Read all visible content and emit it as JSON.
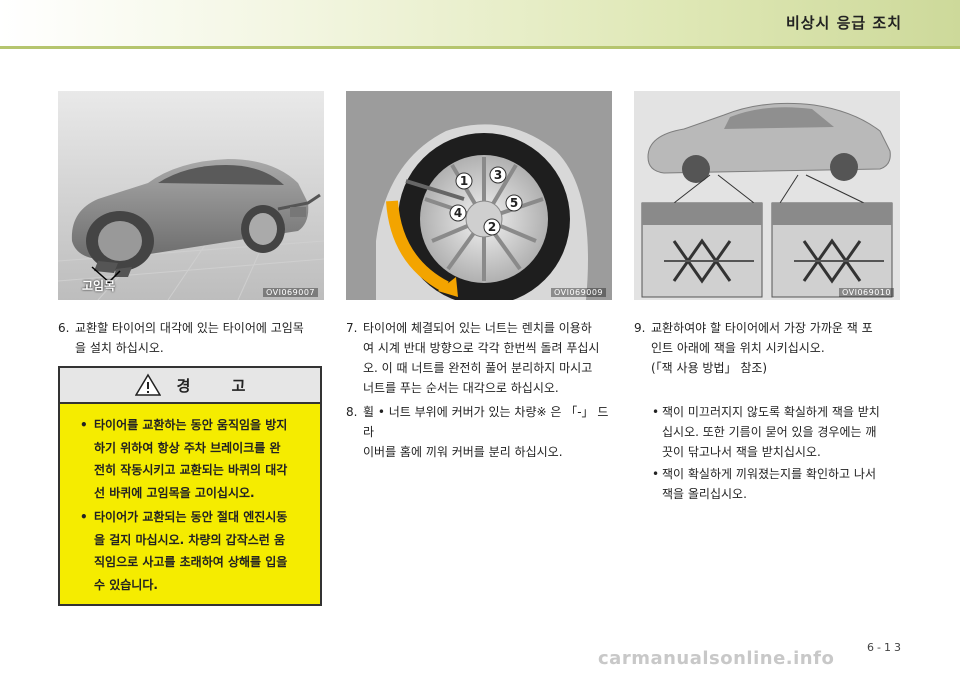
{
  "header": {
    "title": "비상시 응급 조치"
  },
  "figures": [
    {
      "code": "OVI069007",
      "label": "고임목"
    },
    {
      "code": "OVI069009",
      "labels": [
        "1",
        "2",
        "3",
        "4",
        "5"
      ]
    },
    {
      "code": "OVI069010"
    }
  ],
  "col1": {
    "step6": {
      "num": "6.",
      "lines": [
        "교환할 타이어의 대각에 있는 타이어에 고임목",
        "을 설치 하십시오."
      ]
    }
  },
  "warning": {
    "title": "경 고",
    "bullet": "•",
    "items": [
      [
        "타이어를 교환하는 동안 움직임을 방지",
        "하기 위하여 항상 주차 브레이크를 완",
        "전히 작동시키고 교환되는 바퀴의 대각",
        "선 바퀴에 고임목을 고이십시오."
      ],
      [
        "타이어가 교환되는 동안 절대 엔진시동",
        "을 걸지 마십시오. 차량의 갑작스런 움",
        "직임으로 사고를 초래하여 상해를 입을",
        "수 있습니다."
      ]
    ]
  },
  "col2": {
    "step7": {
      "num": "7.",
      "lines": [
        "타이어에 체결되어 있는 너트는 렌치를 이용하",
        "여 시계 반대 방향으로 각각 한번씩 돌려 푸십시",
        "오.  이 때 너트를 완전히 풀어 분리하지 마시고",
        "너트를 푸는 순서는 대각으로 하십시오."
      ]
    },
    "step8": {
      "num": "8.",
      "lines": [
        "휠 • 너트 부위에 커버가 있는 차량※ 은 「-」 드라",
        "이버를 홈에 끼워 커버를 분리 하십시오."
      ]
    }
  },
  "col3": {
    "step9": {
      "num": "9.",
      "lines": [
        "교환하여야 할 타이어에서 가장 가까운 잭 포",
        "인트 아래에 잭을 위치 시키십시오.",
        "(「잭 사용 방법」 참조)"
      ]
    },
    "bullets": [
      {
        "mark": "•",
        "lines": [
          "잭이 미끄러지지 않도록 확실하게 잭을 받치",
          "십시오.  또한 기름이 묻어 있을 경우에는 깨",
          "끗이 닦고나서 잭을 받치십시오."
        ]
      },
      {
        "mark": "•",
        "lines": [
          "잭이 확실하게 끼워졌는지를 확인하고 나서",
          "잭을 올리십시오."
        ]
      }
    ]
  },
  "footer": {
    "page": "6-13",
    "watermark": "carmanualsonline.info"
  }
}
